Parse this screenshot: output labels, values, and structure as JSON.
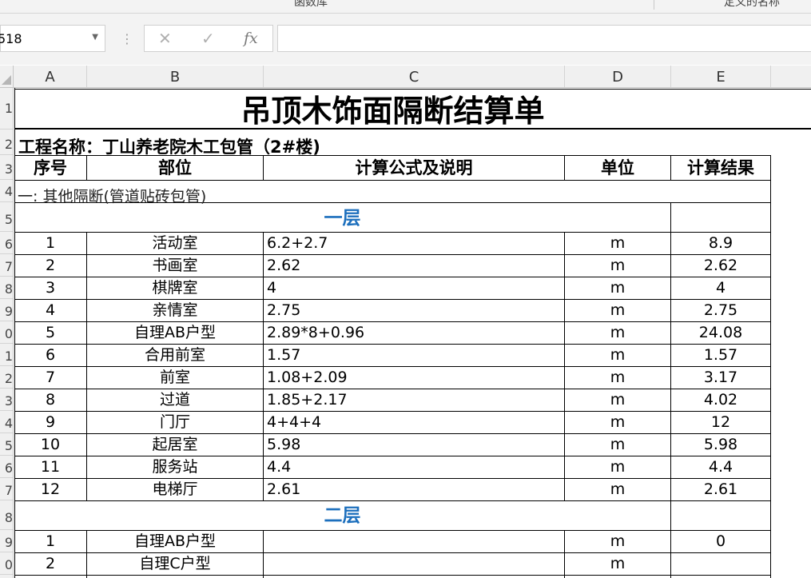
{
  "ribbon": {
    "group_left": "函数库",
    "group_right": "定义的名称"
  },
  "formula_bar": {
    "name_box": "518",
    "cancel_glyph": "✕",
    "enter_glyph": "✓",
    "fx_label": "fx",
    "formula": ""
  },
  "columns": [
    "A",
    "B",
    "C",
    "D",
    "E"
  ],
  "rows": [
    "1",
    "2",
    "3",
    "4",
    "5",
    "6",
    "7",
    "8",
    "9",
    "0",
    "1",
    "2",
    "3",
    "4",
    "5",
    "6",
    "7",
    "8",
    "9",
    "0",
    ""
  ],
  "sheet": {
    "title": "吊顶木饰面隔断结算单",
    "project": "工程名称：丁山养老院木工包管（2#楼)",
    "headers": [
      "序号",
      "部位",
      "计算公式及说明",
      "单位",
      "计算结果"
    ],
    "section": "一:  其他隔断(管道贴砖包管)",
    "floor1": "一层",
    "floor2": "二层",
    "floor1_rows": [
      {
        "no": "1",
        "part": "活动室",
        "formula": "6.2+2.7",
        "unit": "m",
        "result": "8.9"
      },
      {
        "no": "2",
        "part": "书画室",
        "formula": "2.62",
        "unit": "m",
        "result": "2.62"
      },
      {
        "no": "3",
        "part": "棋牌室",
        "formula": "4",
        "unit": "m",
        "result": "4"
      },
      {
        "no": "4",
        "part": "亲情室",
        "formula": "2.75",
        "unit": "m",
        "result": "2.75"
      },
      {
        "no": "5",
        "part": "自理AB户型",
        "formula": "2.89*8+0.96",
        "unit": "m",
        "result": "24.08"
      },
      {
        "no": "6",
        "part": "合用前室",
        "formula": "1.57",
        "unit": "m",
        "result": "1.57"
      },
      {
        "no": "7",
        "part": "前室",
        "formula": "1.08+2.09",
        "unit": "m",
        "result": "3.17"
      },
      {
        "no": "8",
        "part": "过道",
        "formula": "1.85+2.17",
        "unit": "m",
        "result": "4.02"
      },
      {
        "no": "9",
        "part": "门厅",
        "formula": "4+4+4",
        "unit": "m",
        "result": "12"
      },
      {
        "no": "10",
        "part": "起居室",
        "formula": "5.98",
        "unit": "m",
        "result": "5.98"
      },
      {
        "no": "11",
        "part": "服务站",
        "formula": "4.4",
        "unit": "m",
        "result": "4.4"
      },
      {
        "no": "12",
        "part": "电梯厅",
        "formula": "2.61",
        "unit": "m",
        "result": "2.61"
      }
    ],
    "floor2_rows": [
      {
        "no": "1",
        "part": "自理AB户型",
        "formula": "",
        "unit": "m",
        "result": "0"
      },
      {
        "no": "2",
        "part": "自理C户型",
        "formula": "",
        "unit": "m",
        "result": ""
      }
    ]
  },
  "colors": {
    "floor_heading": "#1c6fbd",
    "chrome": "#f0f0f0"
  }
}
